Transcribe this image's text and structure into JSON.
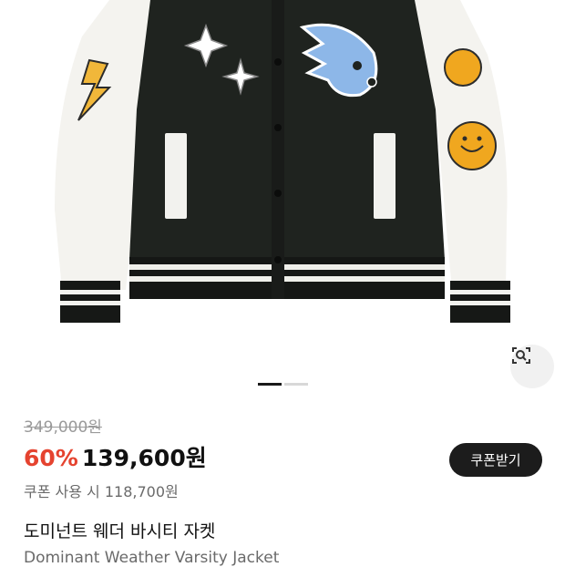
{
  "product": {
    "image_alt": "Dominant Weather Varsity Jacket",
    "original_price": "349,000원",
    "discount_rate": "60%",
    "sale_price": "139,600원",
    "coupon_button_label": "쿠폰받기",
    "coupon_price_text": "쿠폰 사용 시 118,700원",
    "name_ko": "도미넌트 웨더 바시티 자켓",
    "name_en": "Dominant Weather Varsity Jacket"
  },
  "carousel": {
    "total_slides": 2,
    "active_slide": 1
  },
  "icons": {
    "lens": "image-search-icon"
  },
  "colors": {
    "discount": "#e5432f",
    "button_bg": "#1c1c1c",
    "body_fabric": "#1f231f",
    "sleeve_leather": "#f4f3ef"
  }
}
